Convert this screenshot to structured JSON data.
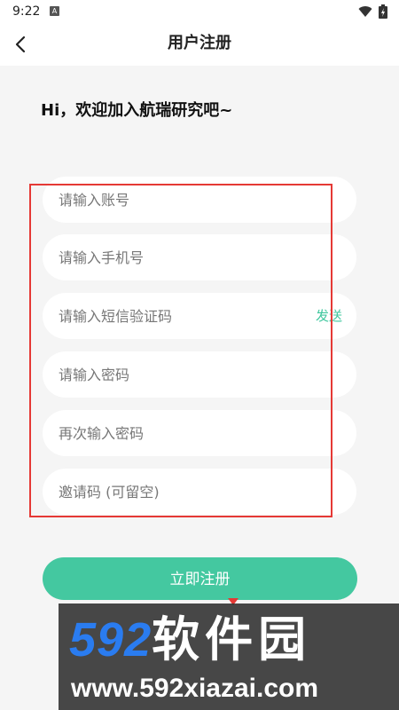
{
  "status_bar": {
    "time": "9:22",
    "notification_icon": "A"
  },
  "header": {
    "title": "用户注册",
    "back_icon": "chevron-left"
  },
  "greeting": "Hi，欢迎加入航瑞研究吧~",
  "form": {
    "account_placeholder": "请输入账号",
    "phone_placeholder": "请输入手机号",
    "sms_code_placeholder": "请输入短信验证码",
    "send_code_label": "发送",
    "password_placeholder": "请输入密码",
    "confirm_password_placeholder": "再次输入密码",
    "invite_code_placeholder": "邀请码 (可留空)",
    "submit_label": "立即注册"
  },
  "colors": {
    "accent": "#44c8a0",
    "send_text": "#3fc79e",
    "annotation_red": "#e53935",
    "background": "#f5f5f5"
  },
  "watermark": {
    "brand": "592软件园",
    "brand_number": "592",
    "brand_text": "软件园",
    "site": "www.592xiazai.com"
  }
}
